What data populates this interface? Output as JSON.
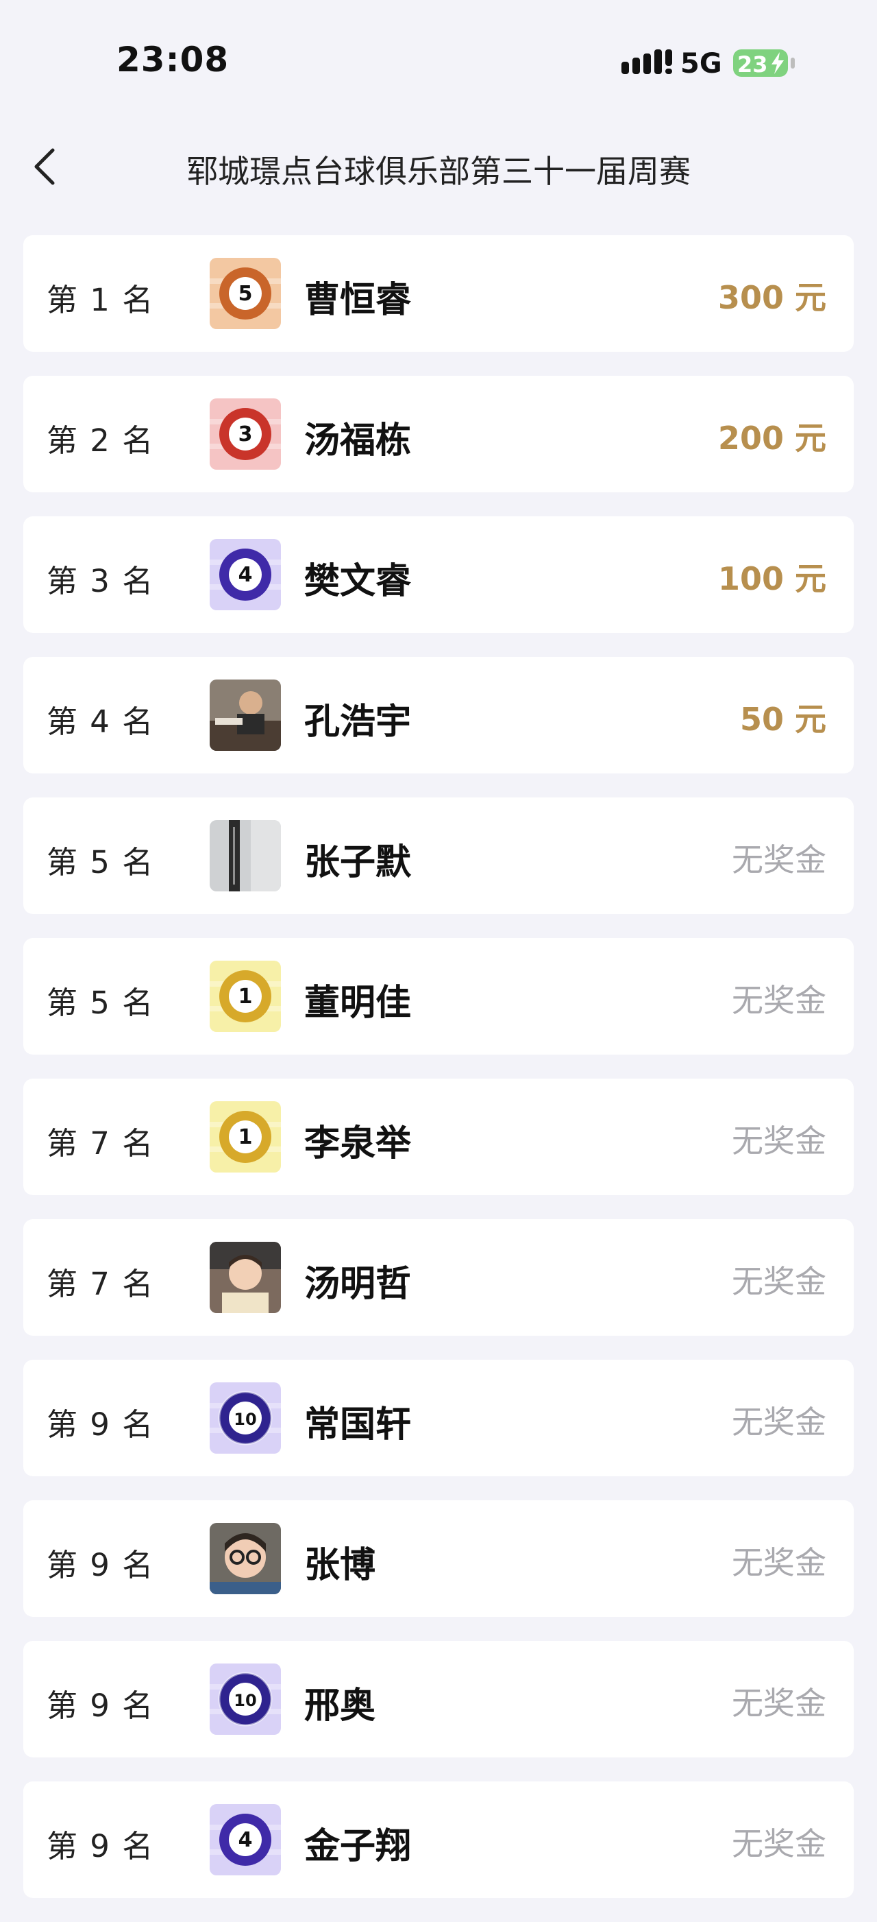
{
  "status_bar": {
    "time": "23:08",
    "network": "5G",
    "battery": "23"
  },
  "nav": {
    "title": "郓城璟点台球俱乐部第三十一届周赛"
  },
  "colors": {
    "background": "#f3f3f9",
    "prize_gold": "#b78f4e",
    "no_prize_gray": "#a9a9ae"
  },
  "rankings": [
    {
      "rank": "第 1 名",
      "name": "曹恒睿",
      "prize": "300 元",
      "has_prize": true,
      "avatar": {
        "type": "ball",
        "number": "5",
        "bg": "#f3c8a2",
        "ring": "#c9652a",
        "stripe": false
      }
    },
    {
      "rank": "第 2 名",
      "name": "汤福栋",
      "prize": "200 元",
      "has_prize": true,
      "avatar": {
        "type": "ball",
        "number": "3",
        "bg": "#f5c4c4",
        "ring": "#c9342a",
        "stripe": false
      }
    },
    {
      "rank": "第 3 名",
      "name": "樊文睿",
      "prize": "100 元",
      "has_prize": true,
      "avatar": {
        "type": "ball",
        "number": "4",
        "bg": "#d9d2f7",
        "ring": "#3f2aa8",
        "stripe": false
      }
    },
    {
      "rank": "第 4 名",
      "name": "孔浩宇",
      "prize": "50 元",
      "has_prize": true,
      "avatar": {
        "type": "photo",
        "scene": "person-photo-1"
      }
    },
    {
      "rank": "第 5 名",
      "name": "张子默",
      "prize": "无奖金",
      "has_prize": false,
      "avatar": {
        "type": "photo",
        "scene": "cue-photo"
      }
    },
    {
      "rank": "第 5 名",
      "name": "董明佳",
      "prize": "无奖金",
      "has_prize": false,
      "avatar": {
        "type": "ball",
        "number": "1",
        "bg": "#f7f0a8",
        "ring": "#d7a92a",
        "stripe": false
      }
    },
    {
      "rank": "第 7 名",
      "name": "李泉举",
      "prize": "无奖金",
      "has_prize": false,
      "avatar": {
        "type": "ball",
        "number": "1",
        "bg": "#f7f0a8",
        "ring": "#d7a92a",
        "stripe": false
      }
    },
    {
      "rank": "第 7 名",
      "name": "汤明哲",
      "prize": "无奖金",
      "has_prize": false,
      "avatar": {
        "type": "photo",
        "scene": "child-photo"
      }
    },
    {
      "rank": "第 9 名",
      "name": "常国轩",
      "prize": "无奖金",
      "has_prize": false,
      "avatar": {
        "type": "ball",
        "number": "10",
        "bg": "#d9d2f7",
        "ring": "#2f238f",
        "stripe": true
      }
    },
    {
      "rank": "第 9 名",
      "name": "张博",
      "prize": "无奖金",
      "has_prize": false,
      "avatar": {
        "type": "photo",
        "scene": "glasses-photo"
      }
    },
    {
      "rank": "第 9 名",
      "name": "邢奥",
      "prize": "无奖金",
      "has_prize": false,
      "avatar": {
        "type": "ball",
        "number": "10",
        "bg": "#d9d2f7",
        "ring": "#2f238f",
        "stripe": true
      }
    },
    {
      "rank": "第 9 名",
      "name": "金子翔",
      "prize": "无奖金",
      "has_prize": false,
      "avatar": {
        "type": "ball",
        "number": "4",
        "bg": "#d9d2f7",
        "ring": "#3f2aa8",
        "stripe": false
      }
    }
  ]
}
